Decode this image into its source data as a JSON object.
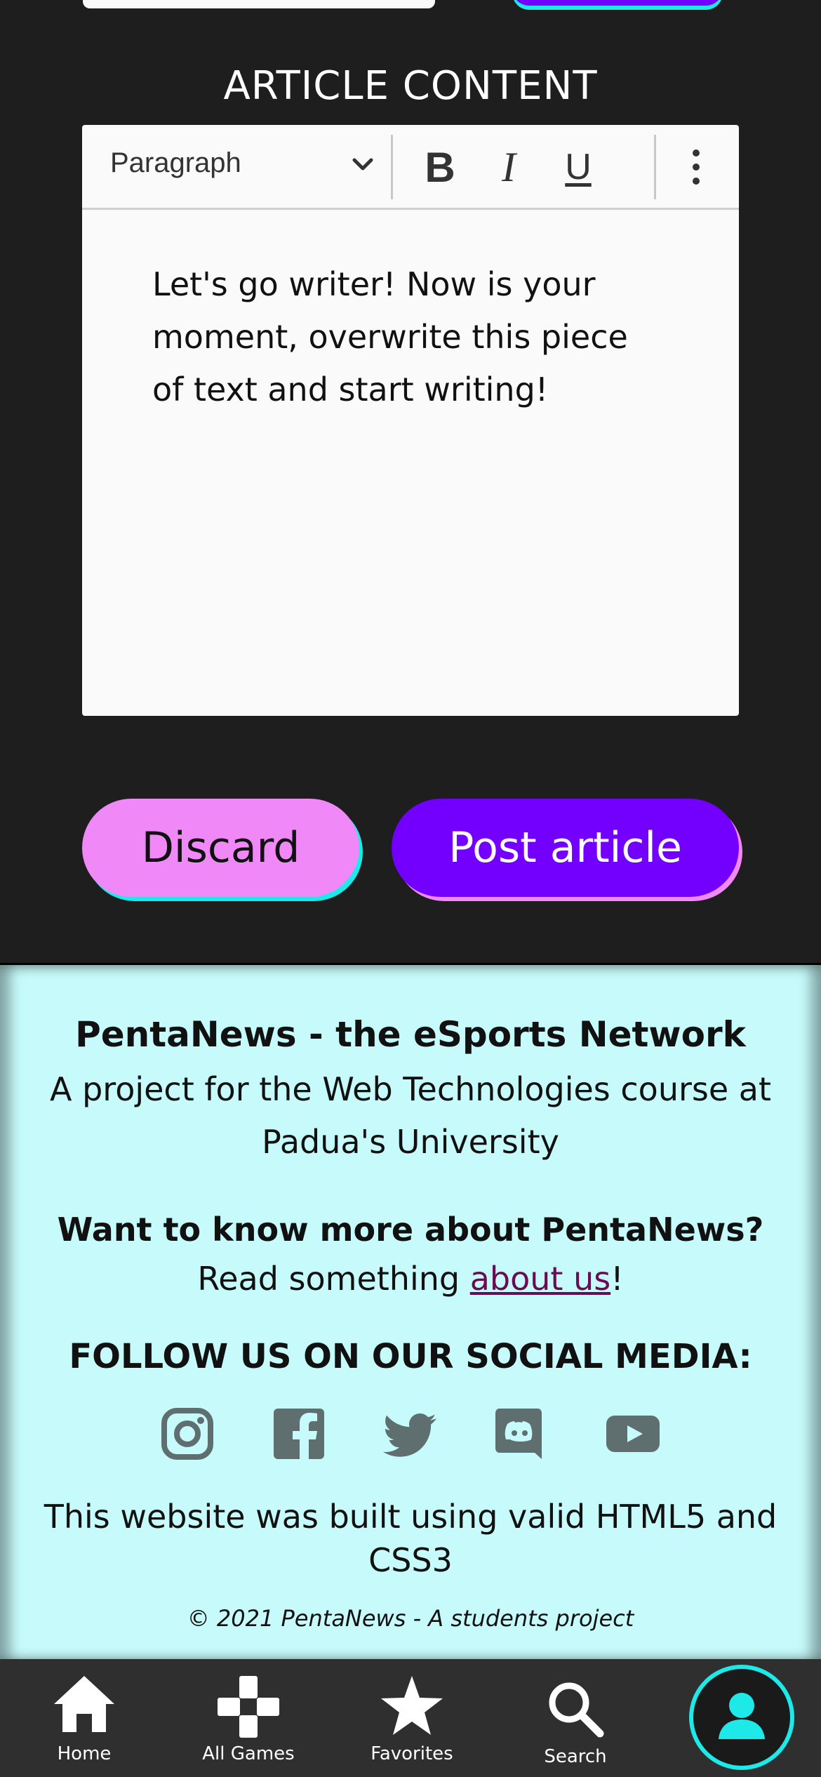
{
  "section_title": "ARTICLE CONTENT",
  "editor": {
    "format_label": "Paragraph",
    "bold_label": "B",
    "italic_label": "I",
    "underline_label": "U",
    "content": "Let's go writer! Now is your moment, overwrite this piece of text and start writing!"
  },
  "actions": {
    "discard_label": "Discard",
    "post_label": "Post article"
  },
  "footer": {
    "title": "PentaNews - the eSports Network",
    "description": "A project for the Web Technologies course at Padua's University",
    "more_title": "Want to know more about PentaNews?",
    "read_prefix": "Read something ",
    "about_link": "about us",
    "read_suffix": "!",
    "follow_title": "FOLLOW US ON OUR SOCIAL MEDIA:",
    "socials": [
      "instagram-icon",
      "facebook-icon",
      "twitter-icon",
      "discord-icon",
      "youtube-icon"
    ],
    "built_text": "This website was built using valid HTML5 and CSS3",
    "copyright": "© 2021 PentaNews - A students project"
  },
  "nav": {
    "home_label": "Home",
    "games_label": "All Games",
    "favorites_label": "Favorites",
    "search_label": "Search"
  },
  "colors": {
    "accent_purple": "#7300ff",
    "accent_pink": "#f089f7",
    "accent_cyan": "#1de9e9",
    "footer_bg": "#c7fbfb"
  }
}
